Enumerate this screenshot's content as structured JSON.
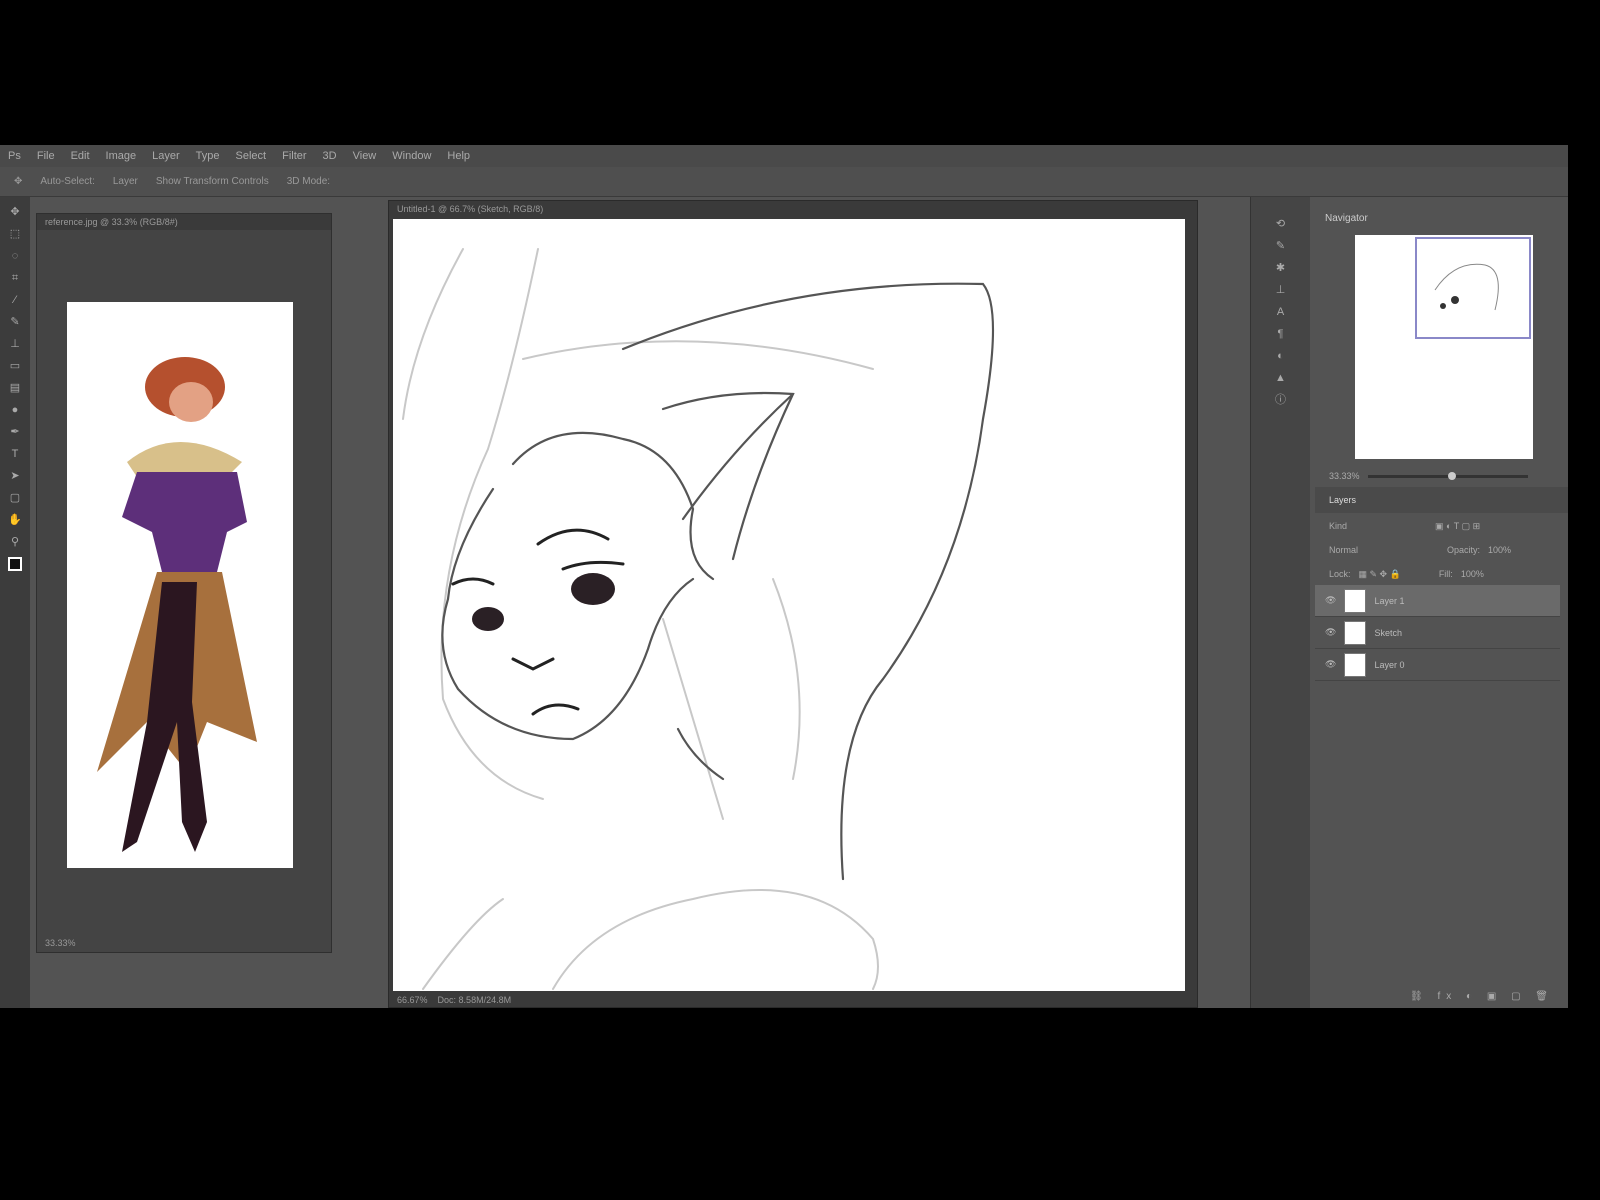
{
  "menu": [
    "Ps",
    "File",
    "Edit",
    "Image",
    "Layer",
    "Type",
    "Select",
    "Filter",
    "3D",
    "View",
    "Window",
    "Help"
  ],
  "options": {
    "auto_select": "Auto-Select:",
    "layer": "Layer",
    "transform": "Show Transform Controls",
    "mode": "3D Mode:"
  },
  "reference_window": {
    "title": "reference.jpg @ 33.3% (RGB/8#)",
    "zoom": "33.33%"
  },
  "main_window": {
    "title": "Untitled-1 @ 66.7% (Sketch, RGB/8)",
    "zoom": "66.67%",
    "doc": "Doc: 8.58M/24.8M"
  },
  "navigator": {
    "title": "Navigator",
    "zoom": "33.33%"
  },
  "layers_panel": {
    "title": "Layers",
    "kind": "Kind",
    "blend": "Normal",
    "opacity_label": "Opacity:",
    "opacity": "100%",
    "lock_label": "Lock:",
    "fill_label": "Fill:",
    "fill": "100%",
    "layers": [
      {
        "name": "Layer 1",
        "selected": true
      },
      {
        "name": "Sketch",
        "selected": false
      },
      {
        "name": "Layer 0",
        "selected": false
      }
    ]
  }
}
